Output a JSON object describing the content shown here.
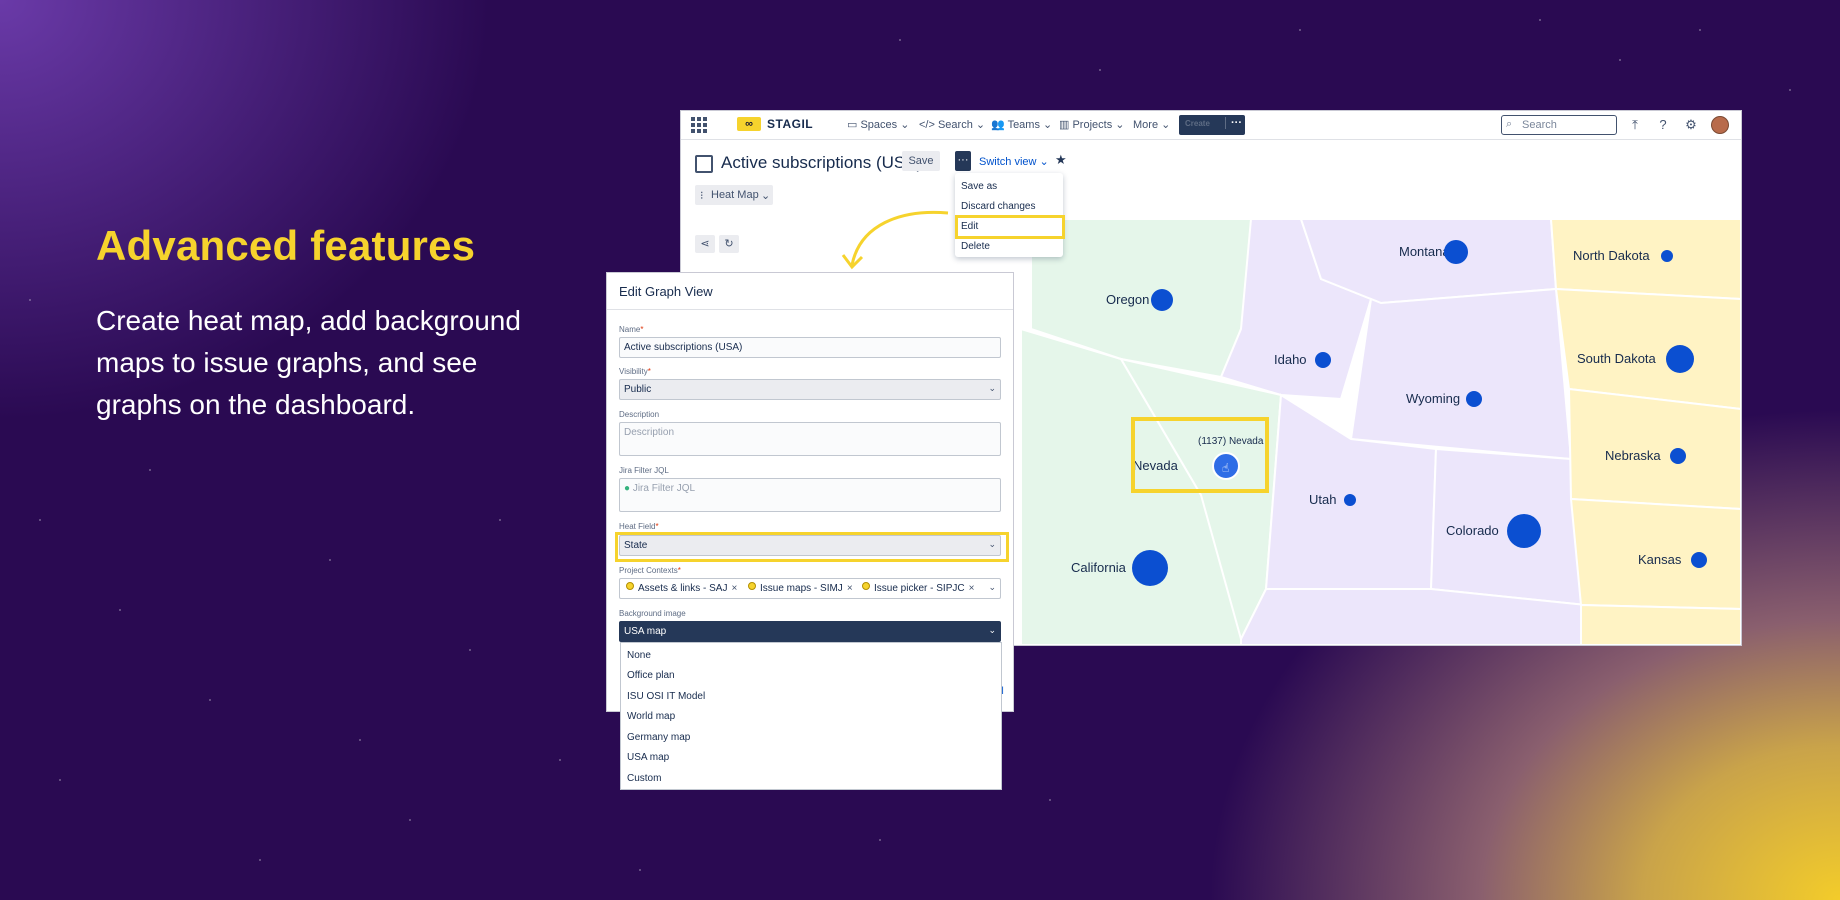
{
  "promo": {
    "title": "Advanced features",
    "body": "Create heat map, add background maps to issue graphs, and see graphs on the dashboard."
  },
  "topnav": {
    "logo": "STAGIL",
    "items": [
      "Spaces",
      "Search",
      "Teams",
      "Projects",
      "More"
    ],
    "create": "Create",
    "search_placeholder": "Search"
  },
  "page": {
    "title": "Active subscriptions (USA)",
    "save": "Save",
    "switch_view": "Switch view",
    "view_type": "Heat Map"
  },
  "actions_menu": [
    "Save as",
    "Discard changes",
    "Edit",
    "Delete"
  ],
  "map": {
    "states": [
      {
        "name": "Montana"
      },
      {
        "name": "North Dakota"
      },
      {
        "name": "Oregon"
      },
      {
        "name": "Idaho"
      },
      {
        "name": "South Dakota"
      },
      {
        "name": "Wyoming"
      },
      {
        "name": "Nebraska"
      },
      {
        "name": "Nevada"
      },
      {
        "name": "Utah"
      },
      {
        "name": "Colorado"
      },
      {
        "name": "Kansas"
      },
      {
        "name": "California"
      }
    ],
    "tooltip": "(1137) Nevada"
  },
  "dialog": {
    "title": "Edit Graph View",
    "name_label": "Name",
    "name_value": "Active subscriptions (USA)",
    "visibility_label": "Visibility",
    "visibility_value": "Public",
    "description_label": "Description",
    "description_placeholder": "Description",
    "jql_label": "Jira Filter JQL",
    "jql_placeholder": "Jira Filter JQL",
    "heat_field_label": "Heat Field",
    "heat_field_value": "State",
    "contexts_label": "Project Contexts",
    "contexts": [
      "Assets & links - SAJ",
      "Issue maps - SIMJ",
      "Issue picker - SIPJC"
    ],
    "bg_label": "Background image",
    "bg_value": "USA map",
    "bg_options": [
      "None",
      "Office plan",
      "ISU OSI IT Model",
      "World map",
      "Germany map",
      "USA map",
      "Custom"
    ],
    "cancel_fragment": "el"
  },
  "colors": {
    "accent_yellow": "#f6d32d",
    "nav_dark": "#253858",
    "link_blue": "#0052cc",
    "bubble_blue": "#0b4fd1"
  }
}
